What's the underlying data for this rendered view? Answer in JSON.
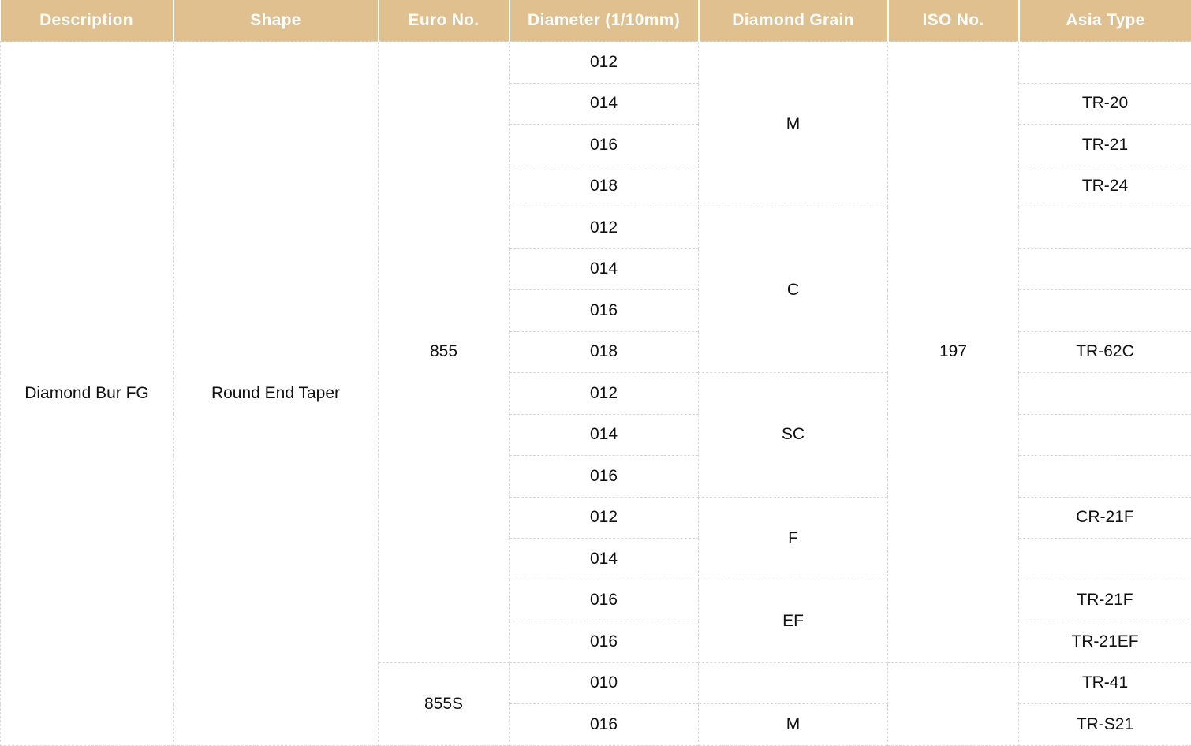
{
  "headers": {
    "description": "Description",
    "shape": "Shape",
    "euro_no": "Euro No.",
    "diameter": "Diameter (1/10mm)",
    "grain": "Diamond Grain",
    "iso_no": "ISO No.",
    "asia_type": "Asia Type"
  },
  "description": "Diamond Bur FG",
  "shape": "Round End Taper",
  "euro": {
    "group1": "855",
    "group2": "855S"
  },
  "iso_no": "197",
  "grains": {
    "m": "M",
    "c": "C",
    "sc": "SC",
    "f": "F",
    "ef": "EF",
    "m2": "M"
  },
  "grain_colors": {
    "M": "#1f77c0",
    "C": "#19b24a",
    "SC": "#111111",
    "F": "#e01b1b",
    "EF": "#f5c211"
  },
  "rows": [
    {
      "diameter": "012",
      "asia": ""
    },
    {
      "diameter": "014",
      "asia": "TR-20"
    },
    {
      "diameter": "016",
      "asia": "TR-21"
    },
    {
      "diameter": "018",
      "asia": "TR-24"
    },
    {
      "diameter": "012",
      "asia": ""
    },
    {
      "diameter": "014",
      "asia": ""
    },
    {
      "diameter": "016",
      "asia": ""
    },
    {
      "diameter": "018",
      "asia": "TR-62C"
    },
    {
      "diameter": "012",
      "asia": ""
    },
    {
      "diameter": "014",
      "asia": ""
    },
    {
      "diameter": "016",
      "asia": ""
    },
    {
      "diameter": "012",
      "asia": "CR-21F"
    },
    {
      "diameter": "014",
      "asia": ""
    },
    {
      "diameter": "016",
      "asia": "TR-21F"
    },
    {
      "diameter": "016",
      "asia": "TR-21EF"
    },
    {
      "diameter": "010",
      "asia": "TR-41"
    },
    {
      "diameter": "016",
      "asia": "TR-S21"
    }
  ]
}
